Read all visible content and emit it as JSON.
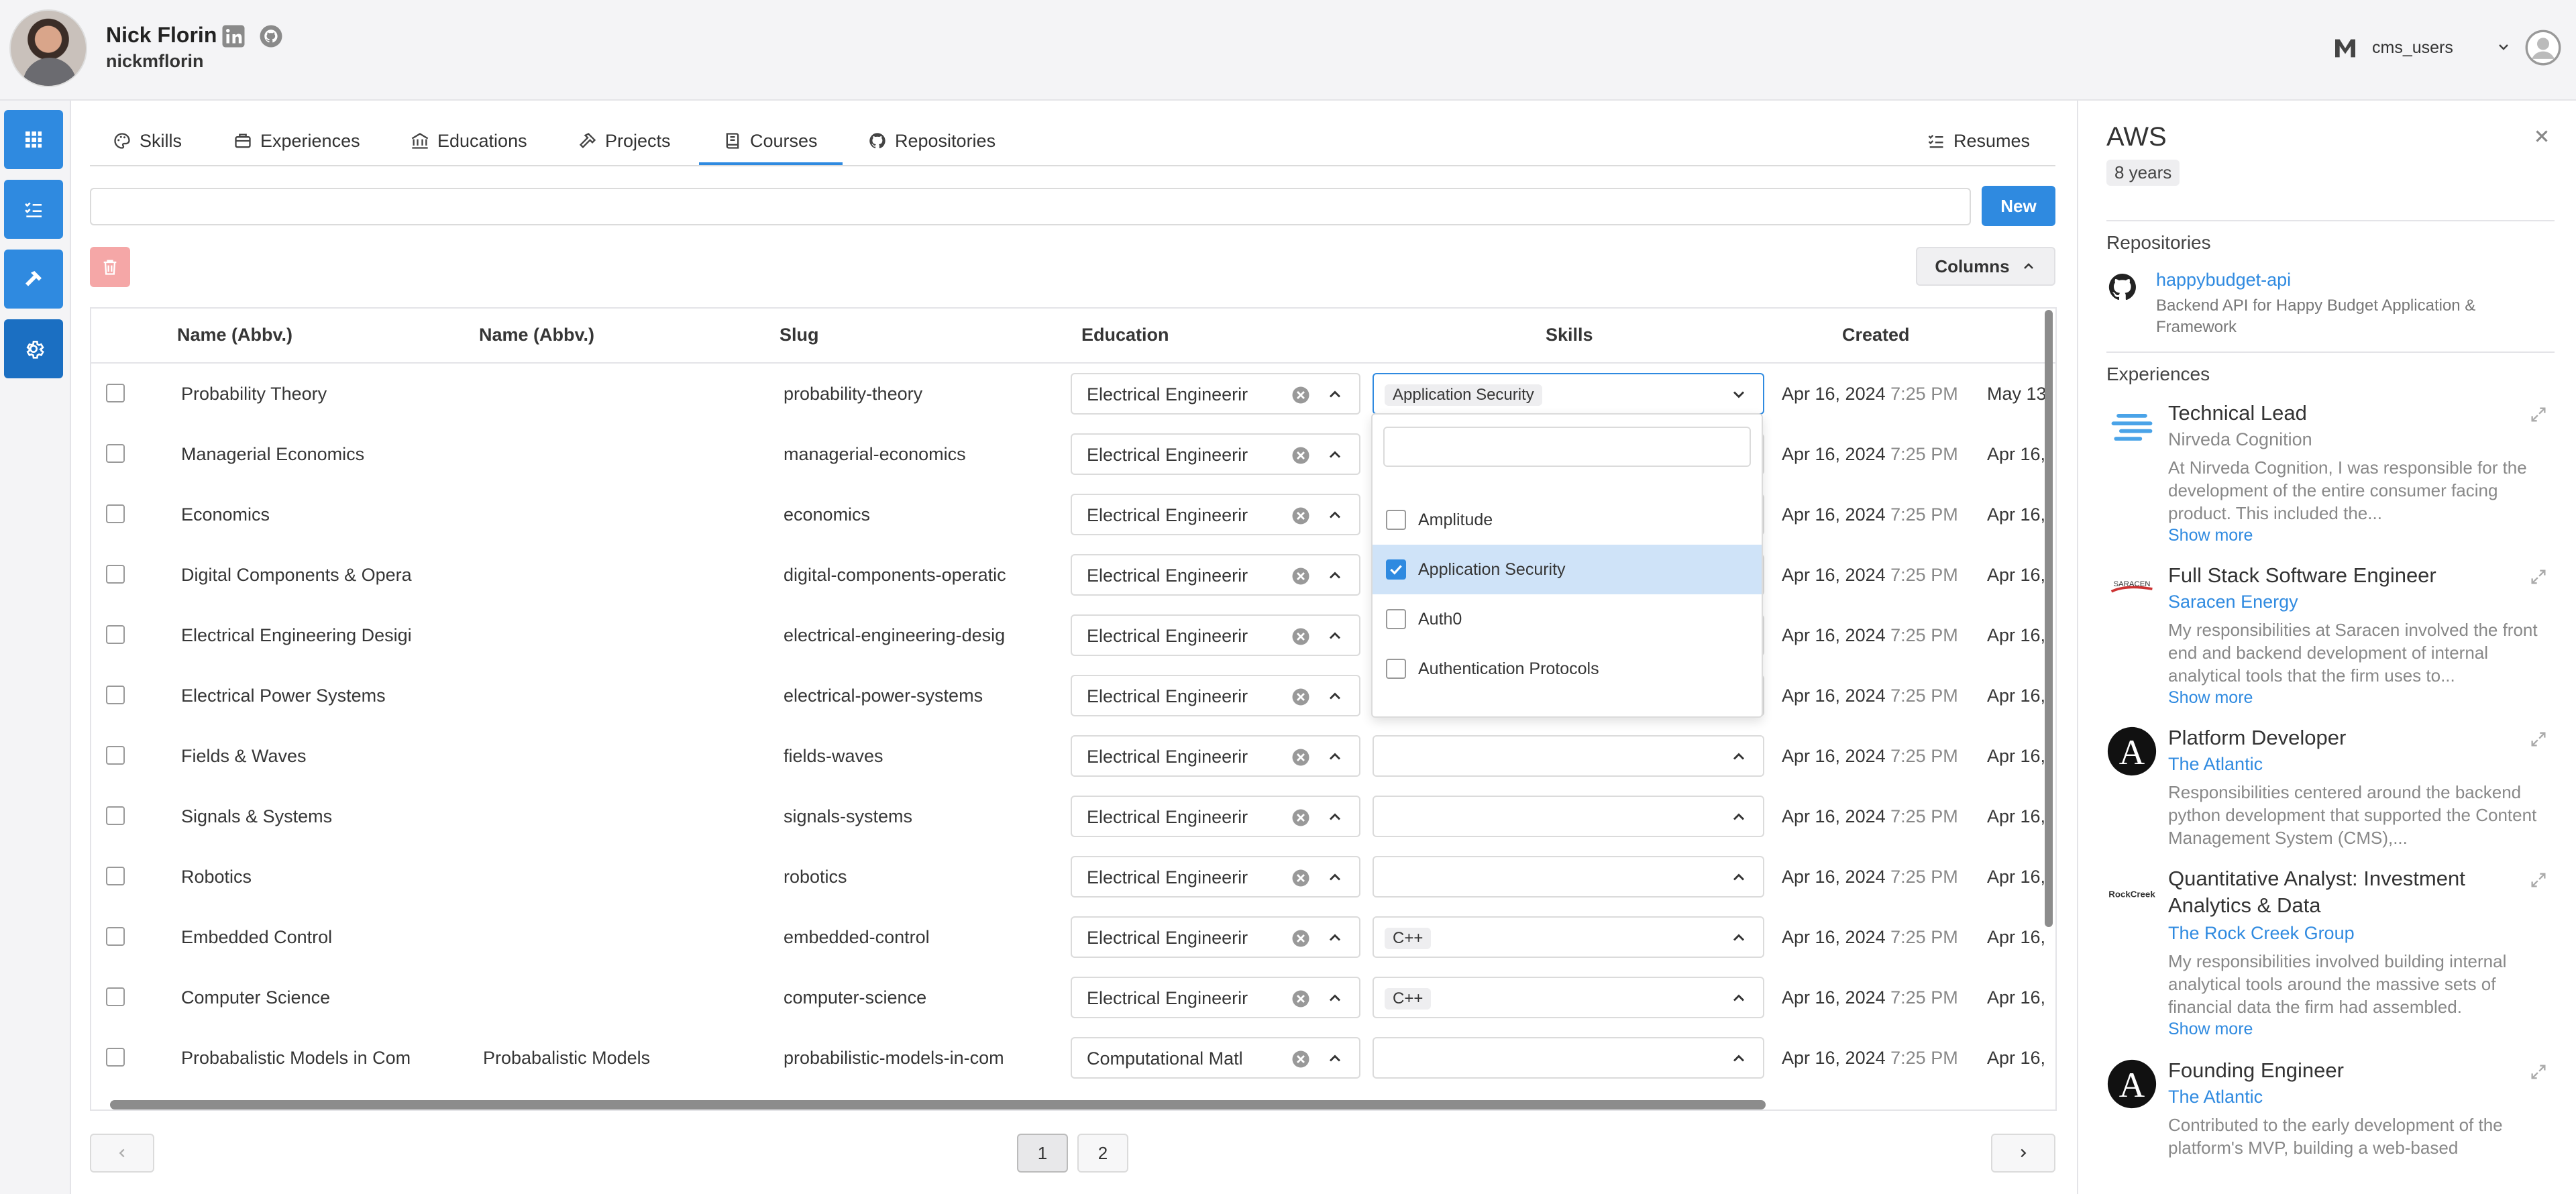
{
  "user": {
    "name": "Nick Florin",
    "handle": "nickmflorin"
  },
  "header": {
    "workspace": "cms_users"
  },
  "tabs": [
    {
      "label": "Skills"
    },
    {
      "label": "Experiences"
    },
    {
      "label": "Educations"
    },
    {
      "label": "Projects"
    },
    {
      "label": "Courses"
    },
    {
      "label": "Repositories"
    }
  ],
  "active_tab": "Courses",
  "resumes_label": "Resumes",
  "search": {
    "value": "",
    "placeholder": ""
  },
  "new_label": "New",
  "columns_label": "Columns",
  "table": {
    "headers": [
      "Name (Abbv.)",
      "Name (Abbv.)",
      "Slug",
      "Education",
      "Skills",
      "Created"
    ],
    "rows": [
      {
        "name": "Probability Theory",
        "abbv": "",
        "slug": "probability-theory",
        "education": "Electrical Engineerir",
        "skills": [
          "Application Security"
        ],
        "created": "Apr 16, 2024",
        "time": "7:25 PM",
        "updated": "May 13,"
      },
      {
        "name": "Managerial Economics",
        "abbv": "",
        "slug": "managerial-economics",
        "education": "Electrical Engineerir",
        "skills": [],
        "created": "Apr 16, 2024",
        "time": "7:25 PM",
        "updated": "Apr 16,"
      },
      {
        "name": "Economics",
        "abbv": "",
        "slug": "economics",
        "education": "Electrical Engineerir",
        "skills": [],
        "created": "Apr 16, 2024",
        "time": "7:25 PM",
        "updated": "Apr 16,"
      },
      {
        "name": "Digital Components & Opera",
        "abbv": "",
        "slug": "digital-components-operatic",
        "education": "Electrical Engineerir",
        "skills": [],
        "created": "Apr 16, 2024",
        "time": "7:25 PM",
        "updated": "Apr 16,"
      },
      {
        "name": "Electrical Engineering Desigi",
        "abbv": "",
        "slug": "electrical-engineering-desig",
        "education": "Electrical Engineerir",
        "skills": [],
        "created": "Apr 16, 2024",
        "time": "7:25 PM",
        "updated": "Apr 16,"
      },
      {
        "name": "Electrical Power Systems",
        "abbv": "",
        "slug": "electrical-power-systems",
        "education": "Electrical Engineerir",
        "skills": [],
        "created": "Apr 16, 2024",
        "time": "7:25 PM",
        "updated": "Apr 16,"
      },
      {
        "name": "Fields & Waves",
        "abbv": "",
        "slug": "fields-waves",
        "education": "Electrical Engineerir",
        "skills": [],
        "created": "Apr 16, 2024",
        "time": "7:25 PM",
        "updated": "Apr 16,"
      },
      {
        "name": "Signals & Systems",
        "abbv": "",
        "slug": "signals-systems",
        "education": "Electrical Engineerir",
        "skills": [],
        "created": "Apr 16, 2024",
        "time": "7:25 PM",
        "updated": "Apr 16,"
      },
      {
        "name": "Robotics",
        "abbv": "",
        "slug": "robotics",
        "education": "Electrical Engineerir",
        "skills": [],
        "created": "Apr 16, 2024",
        "time": "7:25 PM",
        "updated": "Apr 16,"
      },
      {
        "name": "Embedded Control",
        "abbv": "",
        "slug": "embedded-control",
        "education": "Electrical Engineerir",
        "skills": [
          "C++"
        ],
        "created": "Apr 16, 2024",
        "time": "7:25 PM",
        "updated": "Apr 16,"
      },
      {
        "name": "Computer Science",
        "abbv": "",
        "slug": "computer-science",
        "education": "Electrical Engineerir",
        "skills": [
          "C++"
        ],
        "created": "Apr 16, 2024",
        "time": "7:25 PM",
        "updated": "Apr 16,"
      },
      {
        "name": "Probabalistic Models in Com",
        "abbv": "Probabalistic Models",
        "slug": "probabilistic-models-in-com",
        "education": "Computational Matl",
        "skills": [],
        "created": "Apr 16, 2024",
        "time": "7:25 PM",
        "updated": "Apr 16,"
      }
    ]
  },
  "skills_dropdown": {
    "filter_value": "",
    "options": [
      {
        "label": "Amplitude",
        "checked": false
      },
      {
        "label": "Application Security",
        "checked": true
      },
      {
        "label": "Auth0",
        "checked": false
      },
      {
        "label": "Authentication Protocols",
        "checked": false
      }
    ]
  },
  "pagination": {
    "pages": [
      "1",
      "2"
    ],
    "current": "1"
  },
  "panel": {
    "title": "AWS",
    "years": "8 years",
    "repositories_label": "Repositories",
    "repository": {
      "name": "happybudget-api",
      "description": "Backend API for Happy Budget Application & Framework"
    },
    "experiences_label": "Experiences",
    "experiences": [
      {
        "title": "Technical Lead",
        "company": "Nirveda Cognition",
        "company_link": false,
        "description": "At Nirveda Cognition, I was responsible for the development of the entire consumer facing product. This included the...",
        "more": "Show more",
        "logo": "nirveda-logo"
      },
      {
        "title": "Full Stack Software Engineer",
        "company": "Saracen Energy",
        "company_link": true,
        "description": "My responsibilities at Saracen involved the front end and backend development of internal analytical tools that the firm uses to...",
        "more": "Show more",
        "logo": "saracen-logo"
      },
      {
        "title": "Platform Developer",
        "company": "The Atlantic",
        "company_link": true,
        "description": "Responsibilities centered around the backend python development that supported the Content Management System (CMS),...",
        "more": "",
        "logo": "atlantic-logo"
      },
      {
        "title": "Quantitative Analyst: Investment Analytics & Data",
        "company": "The Rock Creek Group",
        "company_link": true,
        "description": "My responsibilities involved building internal analytical tools around the massive sets of financial data the firm had assembled.",
        "more": "Show more",
        "logo": "rockcreek-logo"
      },
      {
        "title": "Founding Engineer",
        "company": "The Atlantic",
        "company_link": true,
        "description": "Contributed to the early development of the platform's MVP, building a web-based",
        "more": "",
        "logo": "atlantic-logo"
      }
    ],
    "rockcreek_logo_text": "RockCreek",
    "atlantic_logo_text": "A",
    "saracen_logo_text": "SARACEN"
  },
  "colors": {
    "accent": "#2f8ae0",
    "danger_light": "#f5a7a7"
  }
}
